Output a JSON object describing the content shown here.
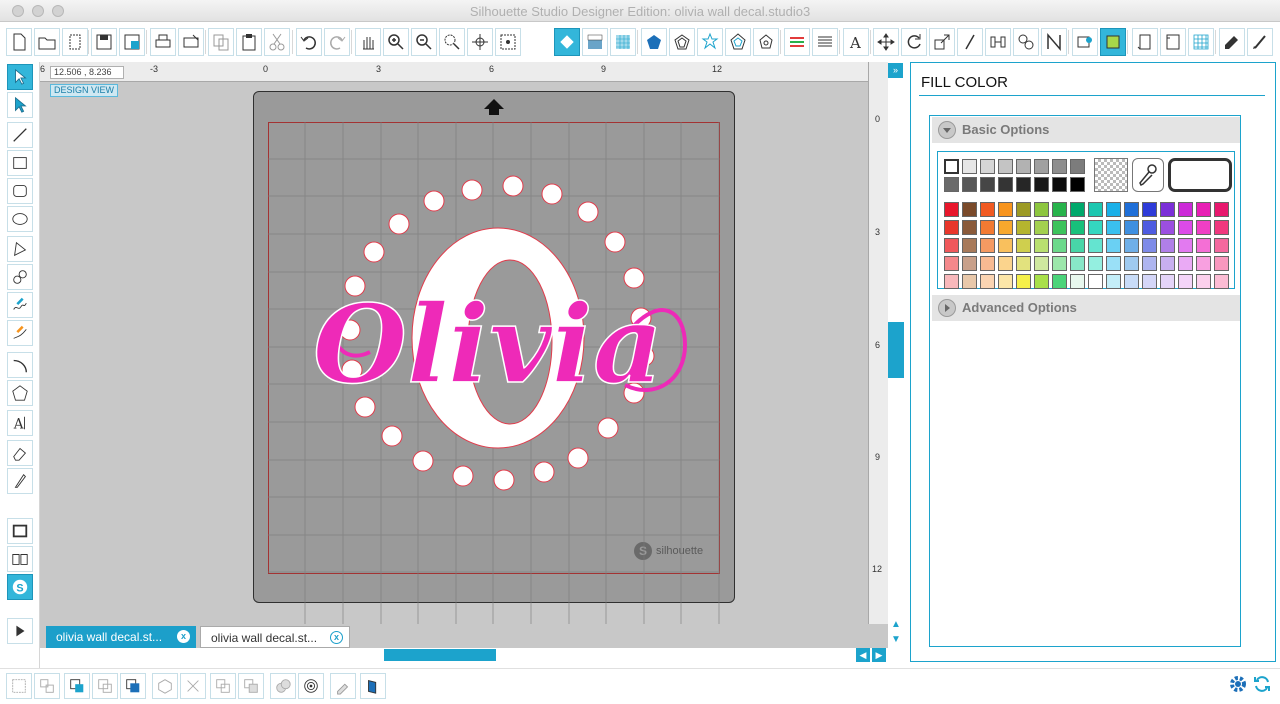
{
  "window": {
    "title": "Silhouette Studio Designer Edition: olivia wall decal.studio3"
  },
  "canvas": {
    "coordinates": "12.506 , 8.236",
    "view_label": "DESIGN VIEW",
    "hruler_labels": [
      "6",
      "-3",
      "0",
      "3",
      "6",
      "9",
      "12"
    ],
    "vruler_labels": [
      "0",
      "3",
      "6",
      "9",
      "12"
    ],
    "design_text": "Olivia",
    "monogram_letter": "O",
    "mat_brand": "silhouette",
    "colors": {
      "mat": "#9a9a9a",
      "workspace": "#c8c8c8",
      "text_fill": "#ee2ab8",
      "cut_line": "#c0392b",
      "accent": "#1ca3cc"
    }
  },
  "tabs": [
    {
      "label": "olivia wall decal.st...",
      "close": "x",
      "active": true
    },
    {
      "label": "olivia wall decal.st...",
      "close": "x",
      "active": false
    }
  ],
  "panel": {
    "title": "FILL COLOR",
    "basic_options_label": "Basic Options",
    "advanced_options_label": "Advanced Options",
    "grays": [
      "#ffffff",
      "#e6e6e6",
      "#d6d6d6",
      "#c4c4c4",
      "#b2b2b2",
      "#a0a0a0",
      "#8e8e8e",
      "#7c7c7c",
      "#6a6a6a",
      "#585858",
      "#464646",
      "#343434",
      "#262626",
      "#181818",
      "#0c0c0c",
      "#000000"
    ],
    "color_rows": [
      [
        "#e8162b",
        "#7a4a2a",
        "#f15a22",
        "#f7941d",
        "#9c9a24",
        "#8dc63f",
        "#27b34b",
        "#00a86b",
        "#1cc7b0",
        "#1ab0e8",
        "#1f6fd8",
        "#2e3bd8",
        "#7b2fd8",
        "#cc2ad8",
        "#e81fb5",
        "#e8186e"
      ],
      [
        "#e8362b",
        "#8a5a3a",
        "#f27a32",
        "#f7a82d",
        "#b5b52e",
        "#a3d04f",
        "#3cc35b",
        "#18c07b",
        "#34d7c0",
        "#3ac0ef",
        "#3f8fe0",
        "#4e5be0",
        "#9b4fe0",
        "#dc4ae8",
        "#f03fc5",
        "#f0387e"
      ],
      [
        "#f0585b",
        "#a87a5a",
        "#f59a62",
        "#f9c05d",
        "#cfcf4e",
        "#b9e06f",
        "#6cd98b",
        "#48d6a8",
        "#64e4d0",
        "#6ad0f3",
        "#6fafe8",
        "#7e8be8",
        "#b07fe8",
        "#e27af0",
        "#f46fd5",
        "#f4689e"
      ],
      [
        "#f4888b",
        "#c8a08a",
        "#f8ba92",
        "#fbd48d",
        "#e2e27e",
        "#cfe89f",
        "#9ce7ab",
        "#88e7c8",
        "#94efe0",
        "#9ae0f7",
        "#9fcaf0",
        "#aeb5f0",
        "#c8aff0",
        "#eaaaf5",
        "#f8a0e0",
        "#f898be"
      ],
      [
        "#f8b8bb",
        "#e8c8aa",
        "#fad4b2",
        "#fce6a8",
        "#f5f04a",
        "#a8e04a",
        "#4ad47a",
        "#e8f8ee",
        "#ffffff",
        "#c4eef8",
        "#c8dcf8",
        "#d4d6f8",
        "#e4d4f8",
        "#f4d4f8",
        "#fcd0ec",
        "#fcbcd4"
      ]
    ]
  }
}
